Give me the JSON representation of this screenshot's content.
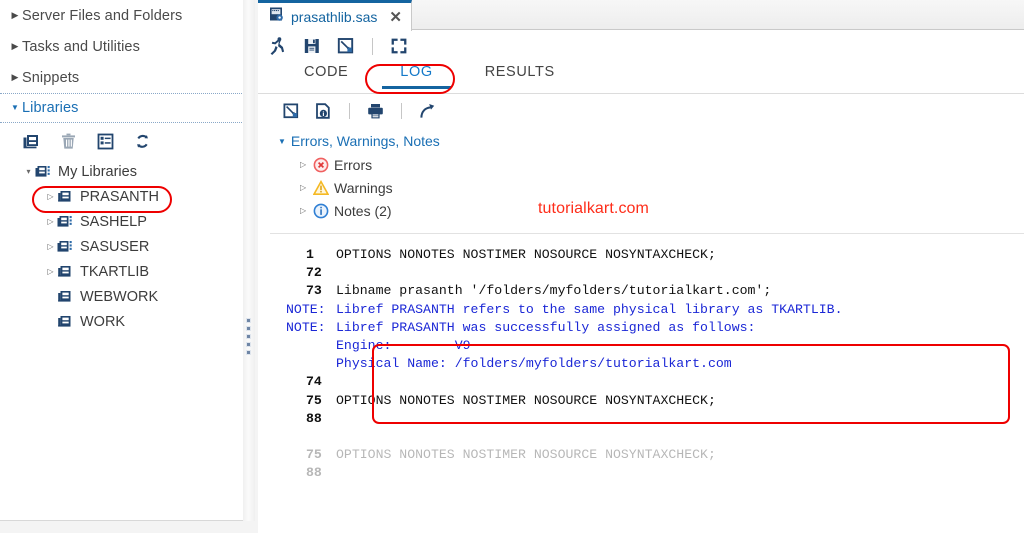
{
  "sidebar": {
    "sections": [
      {
        "label": "Server Files and Folders",
        "icon": "chevron-right-icon",
        "expanded": false
      },
      {
        "label": "Tasks and Utilities",
        "icon": "chevron-right-icon",
        "expanded": false
      },
      {
        "label": "Snippets",
        "icon": "chevron-right-icon",
        "expanded": false
      },
      {
        "label": "Libraries",
        "icon": "chevron-down-icon",
        "expanded": true
      }
    ],
    "toolbar": [
      {
        "name": "new-library-icon",
        "title": "New Library"
      },
      {
        "name": "delete-icon",
        "title": "Delete"
      },
      {
        "name": "properties-icon",
        "title": "Properties"
      },
      {
        "name": "refresh-icon",
        "title": "Refresh"
      }
    ],
    "tree": {
      "root": {
        "label": "My Libraries",
        "icon": "libraries-icon",
        "expanded": true
      },
      "items": [
        {
          "label": "PRASANTH",
          "icon": "library-icon",
          "expandable": true,
          "highlighted": true
        },
        {
          "label": "SASHELP",
          "icon": "libraries-icon",
          "expandable": true,
          "highlighted": false
        },
        {
          "label": "SASUSER",
          "icon": "libraries-icon",
          "expandable": true,
          "highlighted": false
        },
        {
          "label": "TKARTLIB",
          "icon": "library-icon",
          "expandable": true,
          "highlighted": false
        },
        {
          "label": "WEBWORK",
          "icon": "library-icon",
          "expandable": false,
          "highlighted": false
        },
        {
          "label": "WORK",
          "icon": "library-icon",
          "expandable": false,
          "highlighted": false
        }
      ]
    }
  },
  "editor": {
    "file_tab": {
      "label": "prasathlib.sas",
      "icon": "sas-program-icon",
      "close_label": "✕"
    },
    "toolbar": [
      {
        "name": "run-icon",
        "title": "Run"
      },
      {
        "name": "save-icon",
        "title": "Save"
      },
      {
        "name": "save-as-icon",
        "title": "Save As"
      },
      {
        "name": "maximize-icon",
        "title": "Maximize view"
      }
    ],
    "subtabs": [
      {
        "label": "CODE",
        "selected": false
      },
      {
        "label": "LOG",
        "selected": true
      },
      {
        "label": "RESULTS",
        "selected": false
      }
    ]
  },
  "log_panel": {
    "toolbar": [
      {
        "name": "clear-log-icon",
        "title": "Clear log"
      },
      {
        "name": "log-summary-icon",
        "title": "Log summary"
      },
      {
        "name": "print-icon",
        "title": "Print"
      },
      {
        "name": "open-in-new-window-icon",
        "title": "Open in new window"
      }
    ],
    "ewn_tree": {
      "root": "Errors, Warnings, Notes",
      "children": [
        {
          "label": "Errors",
          "icon": "error-icon",
          "color": "#f06060"
        },
        {
          "label": "Warnings",
          "icon": "warning-icon",
          "color": "#f5b923"
        },
        {
          "label": "Notes (2)",
          "icon": "info-icon",
          "color": "#2f7fd4"
        }
      ]
    },
    "watermark": "tutorialkart.com",
    "lines": [
      {
        "gutter": "1",
        "gutter_kind": "num",
        "text": "OPTIONS NONOTES NOSTIMER NOSOURCE NOSYNTAXCHECK;",
        "color": "black",
        "faded": false
      },
      {
        "gutter": "72",
        "gutter_kind": "num",
        "text": "",
        "color": "black",
        "faded": false
      },
      {
        "gutter": "73",
        "gutter_kind": "num",
        "text": "Libname prasanth '/folders/myfolders/tutorialkart.com';",
        "color": "black",
        "faded": false
      },
      {
        "gutter": "NOTE:",
        "gutter_kind": "note",
        "text": "Libref PRASANTH refers to the same physical library as TKARTLIB.",
        "color": "blue",
        "faded": false
      },
      {
        "gutter": "NOTE:",
        "gutter_kind": "note",
        "text": "Libref PRASANTH was successfully assigned as follows:",
        "color": "blue",
        "faded": false
      },
      {
        "gutter": "",
        "gutter_kind": "note",
        "text": "Engine:        V9",
        "color": "blue",
        "faded": false
      },
      {
        "gutter": "",
        "gutter_kind": "note",
        "text": "Physical Name: /folders/myfolders/tutorialkart.com",
        "color": "blue",
        "faded": false
      },
      {
        "gutter": "74",
        "gutter_kind": "num",
        "text": "",
        "color": "black",
        "faded": false
      },
      {
        "gutter": "75",
        "gutter_kind": "num",
        "text": "OPTIONS NONOTES NOSTIMER NOSOURCE NOSYNTAXCHECK;",
        "color": "black",
        "faded": false
      },
      {
        "gutter": "88",
        "gutter_kind": "num",
        "text": "",
        "color": "black",
        "faded": false
      },
      {
        "gutter": "",
        "gutter_kind": "num",
        "text": "",
        "color": "black",
        "faded": false
      },
      {
        "gutter": "75",
        "gutter_kind": "num",
        "text": "OPTIONS NONOTES NOSTIMER NOSOURCE NOSYNTAXCHECK;",
        "color": "black",
        "faded": true
      },
      {
        "gutter": "88",
        "gutter_kind": "num",
        "text": "",
        "color": "black",
        "faded": true
      }
    ]
  },
  "annotations": {
    "accent_red": "#ee0000",
    "items": [
      {
        "name": "prasanth-highlight",
        "shape": "oval"
      },
      {
        "name": "log-tab-highlight",
        "shape": "oval"
      },
      {
        "name": "note-block-highlight",
        "shape": "rounded-rect"
      }
    ]
  },
  "colors": {
    "link_blue": "#1a6fb4",
    "tab_blue": "#1464a0",
    "log_note_blue": "#1b27d6",
    "watermark_red": "#fe2d1a"
  }
}
